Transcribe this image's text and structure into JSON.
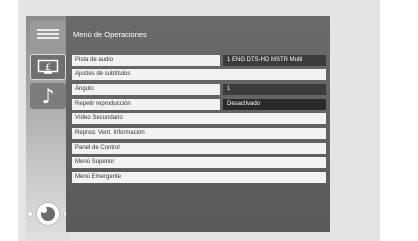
{
  "sidebar": {
    "items": [
      {
        "icon": "list-icon"
      },
      {
        "icon": "monitor-subtitle-icon",
        "glyph": "£"
      },
      {
        "icon": "music-note-icon",
        "glyph": "♪"
      }
    ]
  },
  "menu": {
    "title": "Menú de Operaciones",
    "rows": [
      {
        "label": "Pista de audio",
        "value": "1 ENG DTS-HD MSTR Multi"
      },
      {
        "label": "Ajustes de subtítulos"
      },
      {
        "label": "Ángulo",
        "value": "1"
      },
      {
        "label": "Repetir reproducción",
        "value": "Desactivado"
      },
      {
        "label": "Vídeo Secundario"
      },
      {
        "label": "Reprod. Vent. Información"
      },
      {
        "label": "Panel de Control"
      },
      {
        "label": "Menú Superior"
      },
      {
        "label": "Menú Emergente"
      }
    ]
  },
  "controls": {
    "icon": "directional-pad-icon"
  }
}
